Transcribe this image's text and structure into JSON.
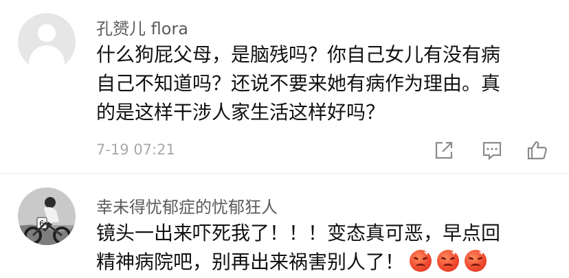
{
  "comments": [
    {
      "username": "孔赟儿 flora",
      "lines": [
        "什么狗屁父母，是脑残吗？你自己女儿有没有病",
        "自己不知道吗？还说不要来她有病作为理由。真",
        "的是这样干涉人家生活这样好吗？"
      ],
      "timestamp": "7-19 07:21",
      "avatar": "default-avatar"
    },
    {
      "username": "幸未得忧郁症的忧郁狂人",
      "lines": [
        "镜头一出来吓死我了！！！变态真可恶，早点回",
        "精神病院吧，别再出来祸害别人了！"
      ],
      "emojis": [
        "angry-emoji",
        "angry-emoji",
        "angry-emoji"
      ],
      "avatar": "motocross-photo"
    }
  ],
  "actions": {
    "share_icon": "share-icon",
    "reply_icon": "comment-icon",
    "like_icon": "thumbs-up-icon"
  }
}
